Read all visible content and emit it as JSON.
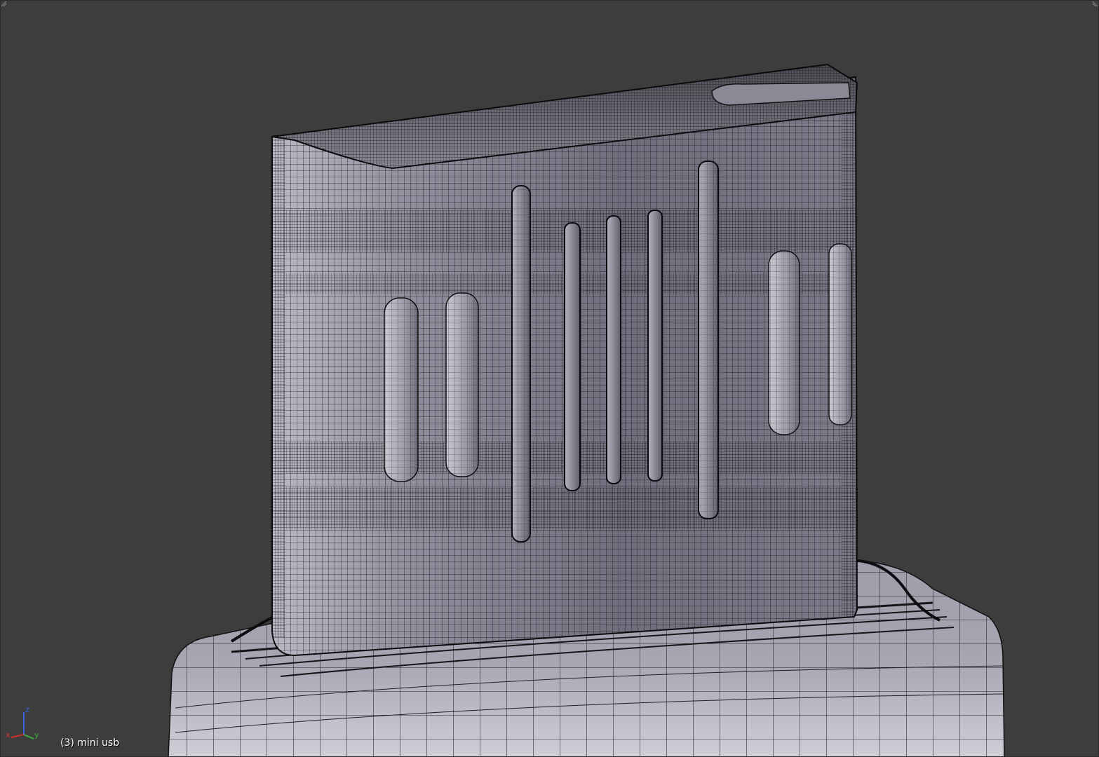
{
  "viewport": {
    "background": "#3d3d3d",
    "object_info": "(3) mini usb",
    "axis_labels": {
      "x": "x",
      "y": "y",
      "z": "z"
    },
    "axis_colors": {
      "x": "#d03030",
      "y": "#3fb03f",
      "z": "#3a63d8"
    },
    "icons": [
      "viewport-split-handle-icon",
      "viewport-corner-handle-icon",
      "axis-gizmo-icon"
    ]
  },
  "mesh": {
    "object_name": "mini usb",
    "shading": "solid with wireframe",
    "surface_color": "#9a9aaa",
    "wire_color": "#000000"
  }
}
